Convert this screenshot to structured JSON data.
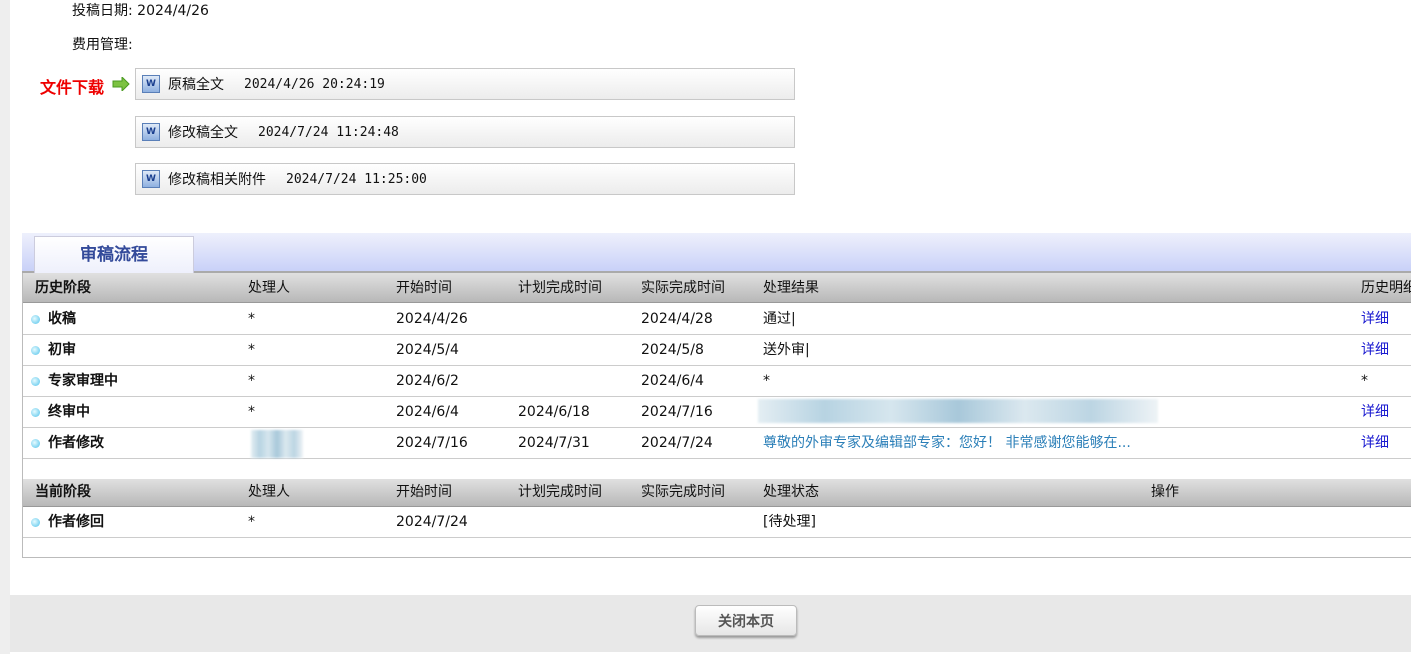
{
  "info": {
    "submit_date_label": "投稿日期:",
    "submit_date": "2024/4/26",
    "fee_label": "费用管理:"
  },
  "downloads": {
    "label": "文件下载",
    "files": [
      {
        "name": "原稿全文",
        "date": "2024/4/26 20:24:19"
      },
      {
        "name": "修改稿全文",
        "date": "2024/7/24 11:24:48"
      },
      {
        "name": "修改稿相关附件",
        "date": "2024/7/24 11:25:00"
      }
    ]
  },
  "review": {
    "tab": "审稿流程",
    "history_headers": [
      "历史阶段",
      "处理人",
      "开始时间",
      "计划完成时间",
      "实际完成时间",
      "处理结果",
      "历史明细"
    ],
    "history_rows": [
      {
        "stage": "收稿",
        "handler": "*",
        "start": "2024/4/26",
        "planned": "",
        "actual": "2024/4/28",
        "result": "通过|",
        "detail": "详细"
      },
      {
        "stage": "初审",
        "handler": "*",
        "start": "2024/5/4",
        "planned": "",
        "actual": "2024/5/8",
        "result": "送外审|",
        "detail": "详细"
      },
      {
        "stage": "专家审理中",
        "handler": "*",
        "start": "2024/6/2",
        "planned": "",
        "actual": "2024/6/4",
        "result": "*",
        "detail": "*"
      },
      {
        "stage": "终审中",
        "handler": "*",
        "start": "2024/6/4",
        "planned": "2024/6/18",
        "actual": "2024/7/16",
        "result": "",
        "detail": "详细"
      },
      {
        "stage": "作者修改",
        "handler": "",
        "start": "2024/7/16",
        "planned": "2024/7/31",
        "actual": "2024/7/24",
        "result": "尊敬的外审专家及编辑部专家：您好！ 非常感谢您能够在...",
        "detail": "详细"
      }
    ],
    "current_headers": [
      "当前阶段",
      "处理人",
      "开始时间",
      "计划完成时间",
      "实际完成时间",
      "处理状态",
      "操作"
    ],
    "current_rows": [
      {
        "stage": "作者修回",
        "handler": "*",
        "start": "2024/7/24",
        "planned": "",
        "actual": "",
        "status": "[待处理]",
        "action": ""
      }
    ]
  },
  "footer": {
    "close_label": "关闭本页"
  }
}
